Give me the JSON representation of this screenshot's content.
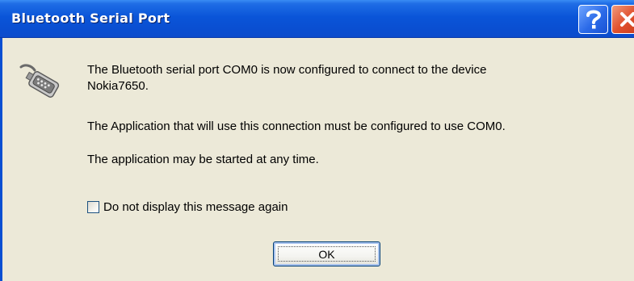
{
  "window": {
    "title": "Bluetooth Serial Port",
    "accent_color": "#0a4fd2",
    "close_color": "#e0502d"
  },
  "title_buttons": {
    "help_icon": "question-mark-icon",
    "close_icon": "close-x-icon"
  },
  "dialog": {
    "icon": "serial-port-connector-icon",
    "message_line1": "The Bluetooth serial port COM0 is now configured to connect to the device",
    "message_line2": "Nokia7650.",
    "message_2": "The Application that will use this connection must be configured to use COM0.",
    "message_3": "The application may be started at any time.",
    "checkbox_label": "Do not display this message again",
    "checkbox_checked": false,
    "ok_label": "OK"
  }
}
